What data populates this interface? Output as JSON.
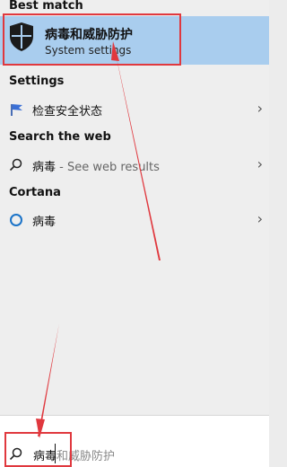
{
  "best_match": {
    "heading": "Best match",
    "title": "病毒和威胁防护",
    "subtitle": "System settings"
  },
  "settings": {
    "heading": "Settings",
    "items": [
      {
        "label": "检查安全状态"
      }
    ]
  },
  "web": {
    "heading": "Search the web",
    "items": [
      {
        "query": "病毒",
        "hint": " - See web results"
      }
    ]
  },
  "cortana": {
    "heading": "Cortana",
    "items": [
      {
        "label": "病毒"
      }
    ]
  },
  "search": {
    "typed": "病毒",
    "suggestion": "和威胁防护"
  },
  "colors": {
    "accent": "#a9cdee",
    "annotation": "#e0383e"
  }
}
